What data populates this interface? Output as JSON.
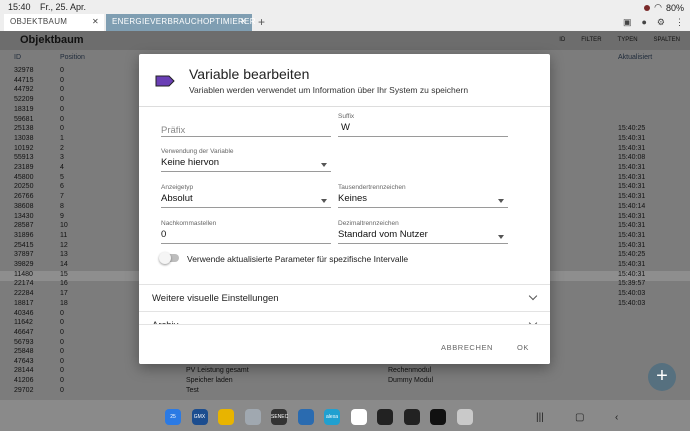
{
  "status": {
    "time": "15:40",
    "date": "Fr., 25. Apr.",
    "battery": "80%"
  },
  "tabs": [
    {
      "label": "OBJEKTBAUM",
      "active": true
    },
    {
      "label": "ENERGIEVERBRAUCHOPTIMIERER",
      "active": false
    }
  ],
  "app": {
    "title": "Objektbaum",
    "toolbar": [
      "ID",
      "FILTER",
      "TYPEN",
      "SPALTEN"
    ],
    "columns": {
      "id": "ID",
      "position": "Position",
      "updated": "Aktualisiert"
    },
    "rows": [
      {
        "id": "32978",
        "pos": "0",
        "time": ""
      },
      {
        "id": "44715",
        "pos": "0",
        "time": ""
      },
      {
        "id": "44792",
        "pos": "0",
        "time": ""
      },
      {
        "id": "52209",
        "pos": "0",
        "time": ""
      },
      {
        "id": "18319",
        "pos": "0",
        "time": ""
      },
      {
        "id": "59681",
        "pos": "0",
        "time": ""
      },
      {
        "id": "25138",
        "pos": "0",
        "time": "15:40:25"
      },
      {
        "id": "13038",
        "pos": "1",
        "time": "15:40:31"
      },
      {
        "id": "10192",
        "pos": "2",
        "time": "15:40:31"
      },
      {
        "id": "55913",
        "pos": "3",
        "time": "15:40:08"
      },
      {
        "id": "23189",
        "pos": "4",
        "time": "15:40:31"
      },
      {
        "id": "45800",
        "pos": "5",
        "time": "15:40:31"
      },
      {
        "id": "20250",
        "pos": "6",
        "time": "15:40:31"
      },
      {
        "id": "26766",
        "pos": "7",
        "time": "15:40:31"
      },
      {
        "id": "38608",
        "pos": "8",
        "time": "15:40:14"
      },
      {
        "id": "13430",
        "pos": "9",
        "time": "15:40:31"
      },
      {
        "id": "28587",
        "pos": "10",
        "time": "15:40:31"
      },
      {
        "id": "31896",
        "pos": "11",
        "time": "15:40:31"
      },
      {
        "id": "25415",
        "pos": "12",
        "time": "15:40:31"
      },
      {
        "id": "37897",
        "pos": "13",
        "time": "15:40:25"
      },
      {
        "id": "39829",
        "pos": "14",
        "time": "15:40:31"
      },
      {
        "id": "11480",
        "pos": "15",
        "time": "15:40:31"
      },
      {
        "id": "22174",
        "pos": "16",
        "time": "15:39:57"
      },
      {
        "id": "22284",
        "pos": "17",
        "time": "15:40:03"
      },
      {
        "id": "18817",
        "pos": "18",
        "time": "15:40:03"
      },
      {
        "id": "40346",
        "pos": "0",
        "time": ""
      },
      {
        "id": "11642",
        "pos": "0",
        "time": ""
      },
      {
        "id": "46647",
        "pos": "0",
        "time": ""
      },
      {
        "id": "56793",
        "pos": "0",
        "time": ""
      },
      {
        "id": "25848",
        "pos": "0",
        "time": ""
      },
      {
        "id": "47643",
        "pos": "0",
        "time": ""
      }
    ],
    "tree_rows": [
      {
        "id": "28144",
        "pos": "0",
        "name": "PV Leistung gesamt",
        "type": "Rechenmodul"
      },
      {
        "id": "41206",
        "pos": "0",
        "name": "Speicher laden",
        "type": "Dummy Modul"
      },
      {
        "id": "29702",
        "pos": "0",
        "name": "Test",
        "type": ""
      }
    ]
  },
  "dialog": {
    "title": "Variable bearbeiten",
    "subtitle": "Variablen werden verwendet um Information über Ihr System zu speichern",
    "prefix": {
      "placeholder": "Präfix",
      "value": ""
    },
    "suffix": {
      "label": "Suffix",
      "value": "W"
    },
    "usage": {
      "label": "Verwendung der Variable",
      "value": "Keine hiervon"
    },
    "display_type": {
      "label": "Anzeigetyp",
      "value": "Absolut"
    },
    "thousands": {
      "label": "Tausendertrennzeichen",
      "value": "Keines"
    },
    "decimals": {
      "label": "Nachkommastellen",
      "value": "0"
    },
    "decimal_sep": {
      "label": "Dezimaltrennzeichen",
      "value": "Standard vom Nutzer"
    },
    "toggle_label": "Verwende aktualisierte Parameter für spezifische Intervalle",
    "toggle_on": false,
    "sections": [
      "Weitere visuelle Einstellungen",
      "Archiv"
    ],
    "cancel": "ABBRECHEN",
    "ok": "OK",
    "accent": "#6a3fb5"
  },
  "dock": [
    {
      "label": "25",
      "color": "#2b7ae4"
    },
    {
      "label": "GMX",
      "color": "#1c4d8f"
    },
    {
      "label": "",
      "color": "#e8b400"
    },
    {
      "label": "",
      "color": "#a0a8b0"
    },
    {
      "label": "SENEC",
      "color": "#333333"
    },
    {
      "label": "",
      "color": "#2a6bb0"
    },
    {
      "label": "alexa",
      "color": "#20a0d0"
    },
    {
      "label": "",
      "color": "#ffffff"
    },
    {
      "label": "",
      "color": "#222222"
    },
    {
      "label": "",
      "color": "#222222"
    },
    {
      "label": "",
      "color": "#111111"
    },
    {
      "label": "",
      "color": "#c9c9c9"
    }
  ]
}
